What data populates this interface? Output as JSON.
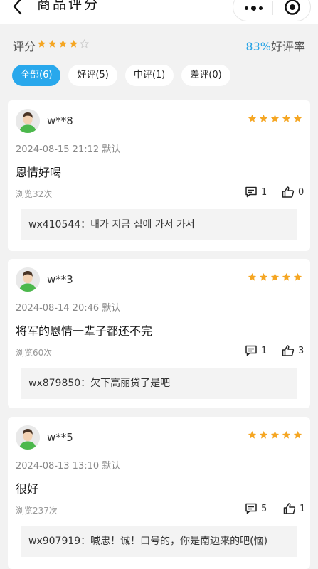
{
  "header": {
    "title": "商品评分"
  },
  "summary": {
    "rating_label": "评分",
    "stars": 4,
    "max_stars": 5,
    "good_rate_value": "83%",
    "good_rate_label": "好评率"
  },
  "tabs": [
    {
      "label": "全部(6)",
      "active": true
    },
    {
      "label": "好评(5)",
      "active": false
    },
    {
      "label": "中评(1)",
      "active": false
    },
    {
      "label": "差评(0)",
      "active": false
    }
  ],
  "reviews": [
    {
      "user": "w**8",
      "stars": 5,
      "date": "2024-08-15 21:12 默认",
      "content": "恩情好喝",
      "views": "浏览32次",
      "comments": "1",
      "likes": "0",
      "reply": "wx410544：내가 지금 집에 가서 가서"
    },
    {
      "user": "w**3",
      "stars": 5,
      "date": "2024-08-14 20:46 默认",
      "content": "将军的恩情一辈子都还不完",
      "views": "浏览60次",
      "comments": "1",
      "likes": "3",
      "reply": "wx879850：欠下高丽贷了是吧"
    },
    {
      "user": "w**5",
      "stars": 5,
      "date": "2024-08-13 13:10 默认",
      "content": "很好",
      "views": "浏览237次",
      "comments": "5",
      "likes": "1",
      "reply": "wx907919：喊忠！诚！口号的，你是南边来的吧(恼)"
    }
  ],
  "colors": {
    "accent": "#29a8ec",
    "star_filled": "#f5a623",
    "star_empty": "#cccccc",
    "rate_text": "#29a4e6"
  },
  "icons": {
    "back": "chevron-left-icon",
    "more": "more-dots-icon",
    "close": "target-icon",
    "comment": "comment-icon",
    "like": "thumbs-up-icon"
  }
}
